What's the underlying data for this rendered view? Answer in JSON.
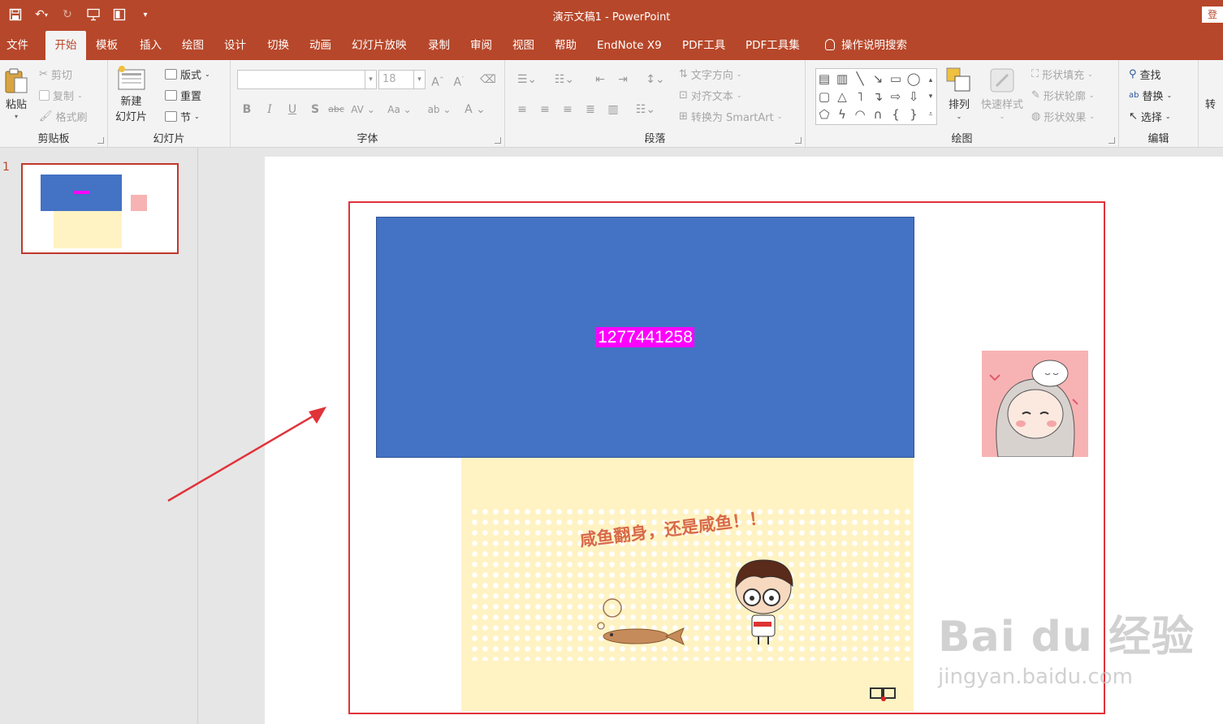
{
  "window": {
    "title": "演示文稿1  -  PowerPoint",
    "login_label": "登"
  },
  "tabs": [
    "文件",
    "开始",
    "模板",
    "插入",
    "绘图",
    "设计",
    "切换",
    "动画",
    "幻灯片放映",
    "录制",
    "审阅",
    "视图",
    "帮助",
    "EndNote X9",
    "PDF工具",
    "PDF工具集",
    "操作说明搜索"
  ],
  "ribbon": {
    "clipboard": {
      "label": "剪贴板",
      "paste": "粘贴",
      "cut": "剪切",
      "copy": "复制",
      "format_painter": "格式刷"
    },
    "slides": {
      "label": "幻灯片",
      "new_slide_1": "新建",
      "new_slide_2": "幻灯片",
      "layout": "版式",
      "reset": "重置",
      "section": "节"
    },
    "font": {
      "label": "字体",
      "font_name": "",
      "font_size": "18"
    },
    "paragraph": {
      "label": "段落",
      "text_direction": "文字方向",
      "align_text": "对齐文本",
      "convert_smartart": "转换为 SmartArt"
    },
    "drawing": {
      "label": "绘图",
      "arrange": "排列",
      "quick_styles": "快速样式",
      "shape_fill": "形状填充",
      "shape_outline": "形状轮廓",
      "shape_effects": "形状效果"
    },
    "editing": {
      "label": "编辑",
      "find": "查找",
      "replace": "替换",
      "select": "选择"
    },
    "convert": {
      "label": "转"
    }
  },
  "thumbnails": {
    "slide_number": "1"
  },
  "slide": {
    "blue_box_text": "1277441258",
    "image_caption": "咸鱼翻身，还是咸鱼！！"
  },
  "watermark": {
    "brand": "Bai du 经验",
    "url": "jingyan.baidu.com"
  }
}
